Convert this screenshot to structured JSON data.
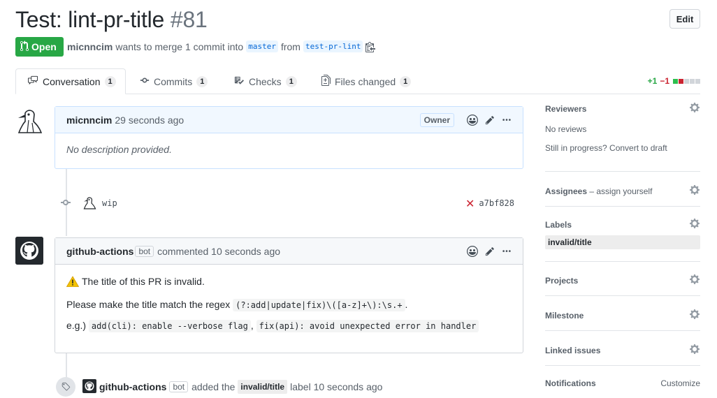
{
  "pr": {
    "title": "Test: lint-pr-title",
    "number": "#81",
    "edit_label": "Edit",
    "state_label": "Open",
    "author": "micnncim",
    "merge_text": "wants to merge 1 commit into",
    "base_branch": "master",
    "from_text": "from",
    "head_branch": "test-pr-lint"
  },
  "tabs": [
    {
      "label": "Conversation",
      "count": "1"
    },
    {
      "label": "Commits",
      "count": "1"
    },
    {
      "label": "Checks",
      "count": "1"
    },
    {
      "label": "Files changed",
      "count": "1"
    }
  ],
  "diffstat": {
    "additions": "+1",
    "deletions": "−1",
    "colors": [
      "#2cbe4e",
      "#cb2431",
      "#d1d5da",
      "#d1d5da",
      "#d1d5da"
    ]
  },
  "comment1": {
    "author": "micnncim",
    "time": "29 seconds ago",
    "role": "Owner",
    "body": "No description provided."
  },
  "commit": {
    "message": "wip",
    "sha": "a7bf828",
    "status_icon": "x-icon"
  },
  "comment2": {
    "author": "github-actions",
    "badge": "bot",
    "action": "commented 10 seconds ago",
    "warning_text": "The title of this PR is invalid.",
    "regex_prefix": "Please make the title match the regex",
    "regex": "(?:add|update|fix)\\([a-z]+\\):\\s.+",
    "regex_suffix": ".",
    "example_prefix": "e.g.)",
    "example1": "add(cli): enable --verbose flag",
    "example_sep": ",",
    "example2": "fix(api): avoid unexpected error in handler"
  },
  "label_event": {
    "actor": "github-actions",
    "badge": "bot",
    "action": "added the",
    "label": "invalid/title",
    "suffix": "label 10 seconds ago"
  },
  "sidebar": {
    "reviewers_title": "Reviewers",
    "reviewers_value": "No reviews",
    "draft_text": "Still in progress? Convert to draft",
    "assignees_title": "Assignees",
    "assignees_hint": "– assign yourself",
    "labels_title": "Labels",
    "label_value": "invalid/title",
    "projects_title": "Projects",
    "milestone_title": "Milestone",
    "linked_title": "Linked issues",
    "notifications_title": "Notifications",
    "notifications_action": "Customize"
  }
}
